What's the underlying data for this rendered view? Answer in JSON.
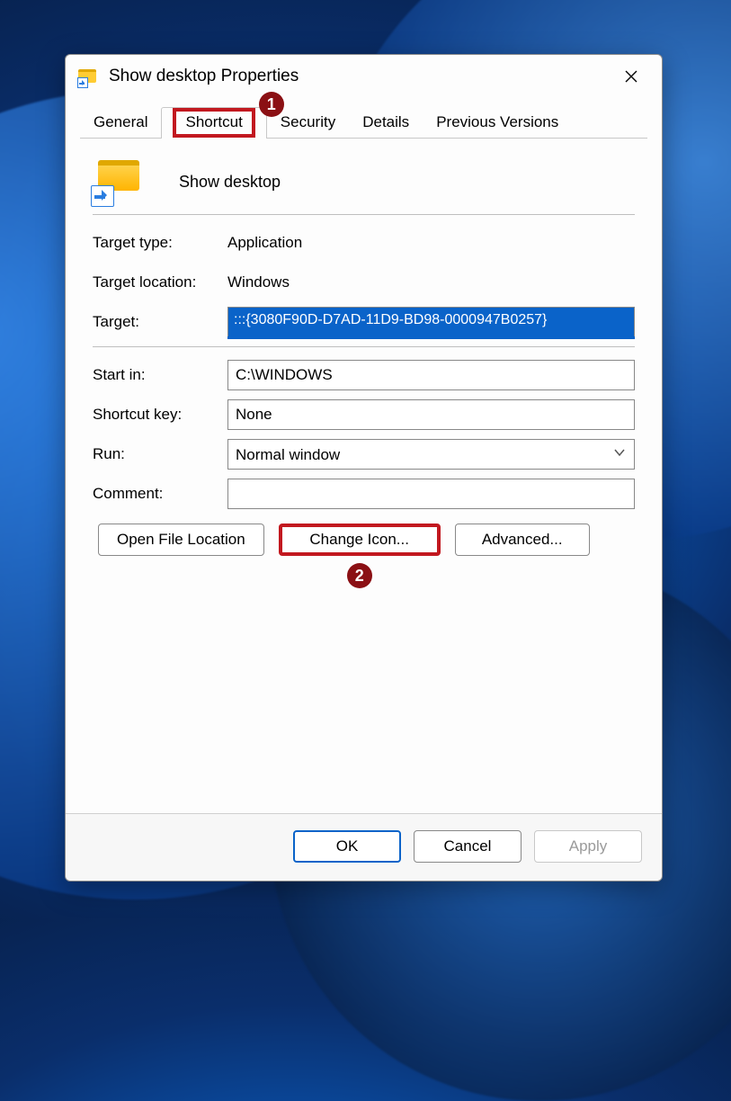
{
  "window": {
    "title": "Show desktop Properties"
  },
  "tabs": {
    "general": "General",
    "shortcut": "Shortcut",
    "security": "Security",
    "details": "Details",
    "previous": "Previous Versions"
  },
  "callouts": {
    "one": "1",
    "two": "2"
  },
  "shortcut": {
    "name": "Show desktop",
    "target_type_label": "Target type:",
    "target_type_value": "Application",
    "target_location_label": "Target location:",
    "target_location_value": "Windows",
    "target_label": "Target:",
    "target_value": ":::{3080F90D-D7AD-11D9-BD98-0000947B0257}",
    "start_in_label": "Start in:",
    "start_in_value": "C:\\WINDOWS",
    "shortcut_key_label": "Shortcut key:",
    "shortcut_key_value": "None",
    "run_label": "Run:",
    "run_value": "Normal window",
    "comment_label": "Comment:",
    "comment_value": ""
  },
  "buttons": {
    "open_file_location": "Open File Location",
    "change_icon": "Change Icon...",
    "advanced": "Advanced...",
    "ok": "OK",
    "cancel": "Cancel",
    "apply": "Apply"
  }
}
